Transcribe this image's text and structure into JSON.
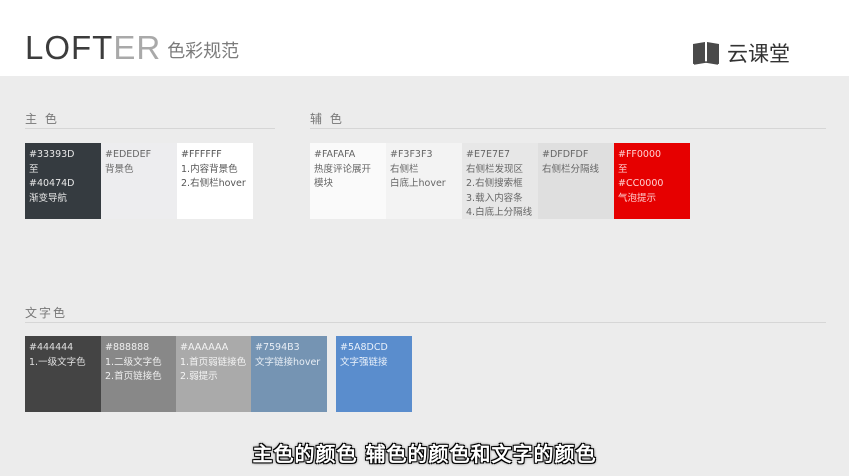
{
  "header": {
    "logo_main": "LOFT",
    "logo_soft": "ER",
    "logo_sub": "色彩规范",
    "brand_icon": "book-icon",
    "brand_text": "云课堂"
  },
  "sections": {
    "main_title": "主 色",
    "aux_title": "辅 色",
    "text_title": "文字色"
  },
  "main_colors": [
    {
      "lines": [
        "#33393D",
        "至",
        "#40474D",
        "渐变导航"
      ],
      "bg": "#353b40",
      "fg": "#e8e8e8"
    },
    {
      "lines": [
        "#EDEDEF",
        "背景色"
      ],
      "bg": "#ededef",
      "fg": "#666666"
    },
    {
      "lines": [
        "#FFFFFF",
        "1.内容背景色",
        "2.右侧栏hover"
      ],
      "bg": "#ffffff",
      "fg": "#555555"
    }
  ],
  "aux_colors": [
    {
      "lines": [
        "#FAFAFA",
        "热度评论展开",
        "模块"
      ],
      "bg": "#fafafa",
      "fg": "#666666"
    },
    {
      "lines": [
        "#F3F3F3",
        "右侧栏",
        "白底上hover"
      ],
      "bg": "#f3f3f3",
      "fg": "#666666"
    },
    {
      "lines": [
        "#E7E7E7",
        "右侧栏发现区",
        "2.右侧搜索框",
        "3.载入内容条",
        "4.白底上分隔线"
      ],
      "bg": "#e7e7e7",
      "fg": "#666666"
    },
    {
      "lines": [
        "#DFDFDF",
        "右侧栏分隔线"
      ],
      "bg": "#dfdfdf",
      "fg": "#666666"
    },
    {
      "lines": [
        "#FF0000",
        "至",
        "#CC0000",
        "气泡提示"
      ],
      "bg": "#e60000",
      "fg": "#ffd0d0"
    }
  ],
  "text_colors": [
    {
      "lines": [
        "#444444",
        "1.一级文字色"
      ],
      "bg": "#444444",
      "fg": "#e0e0e0"
    },
    {
      "lines": [
        "#888888",
        "1.二级文字色",
        "2.首页链接色"
      ],
      "bg": "#888888",
      "fg": "#f0f0f0"
    },
    {
      "lines": [
        "#AAAAAA",
        "1.首页弱链接色",
        "2.弱提示"
      ],
      "bg": "#aaaaaa",
      "fg": "#f4f4f4"
    },
    {
      "lines": [
        "#7594B3",
        "文字链接hover"
      ],
      "bg": "#7594b3",
      "fg": "#e8eef5"
    },
    {
      "lines": [
        "#5A8DCD",
        "文字强链接"
      ],
      "bg": "#5a8dcd",
      "fg": "#e8f0fa"
    }
  ],
  "caption": "主色的颜色 辅色的颜色和文字的颜色"
}
